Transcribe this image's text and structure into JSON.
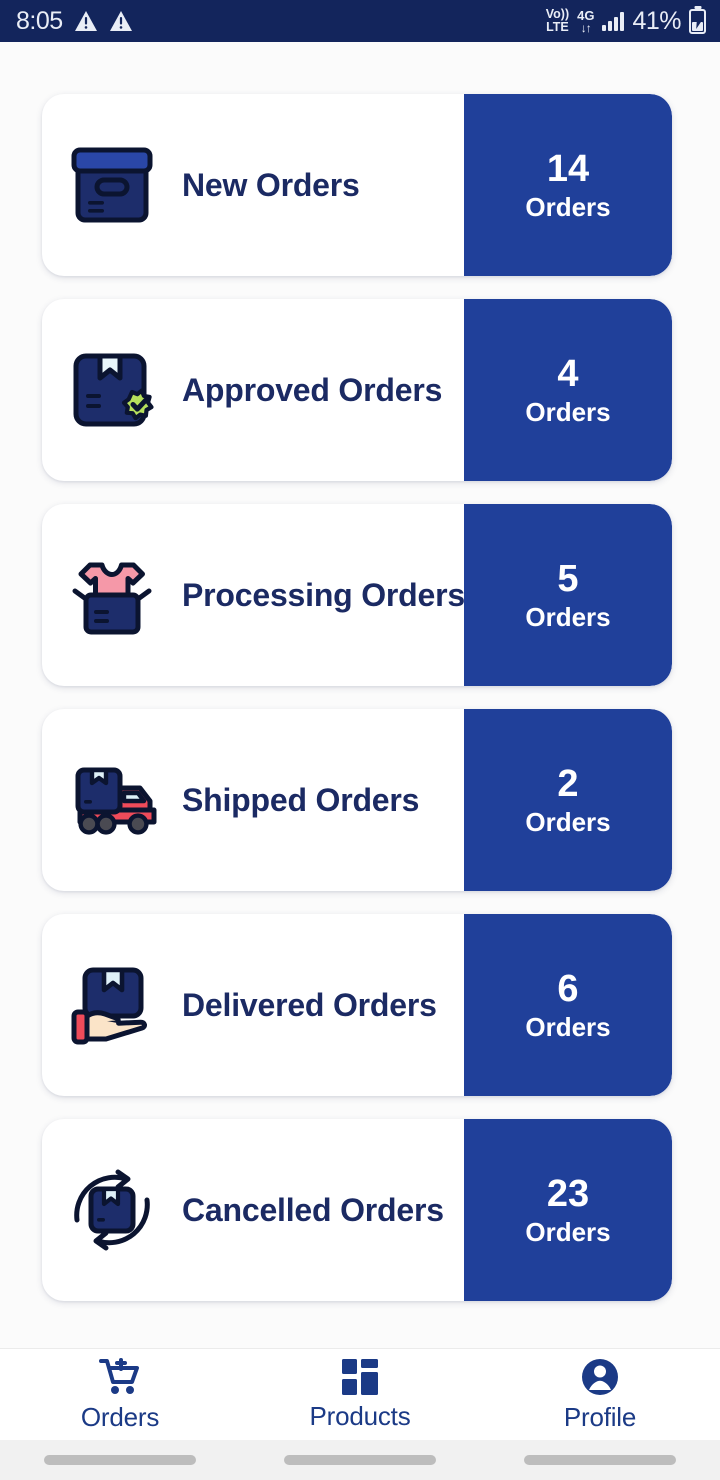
{
  "status_bar": {
    "time": "8:05",
    "warning_icons": [
      "warning-triangle-icon",
      "warning-triangle-icon"
    ],
    "volte_top": "Vo))",
    "volte_bottom": "LTE",
    "network_type": "4G",
    "data_arrows": "↓↑",
    "signal_icon": "signal-bars-icon",
    "battery_percent": "41%",
    "battery_icon": "battery-charging-icon",
    "background_color": "#13255c"
  },
  "theme": {
    "accent_blue": "#20409a",
    "title_navy": "#1b2a63",
    "page_background": "#fbfbfb",
    "card_background": "#ffffff"
  },
  "orders": {
    "cards": [
      {
        "icon": "archive-box-icon",
        "title": "New Orders",
        "count": "14",
        "unit": "Orders"
      },
      {
        "icon": "box-approved-icon",
        "title": "Approved Orders",
        "count": "4",
        "unit": "Orders"
      },
      {
        "icon": "open-box-shirt-icon",
        "title": "Processing Orders",
        "count": "5",
        "unit": "Orders"
      },
      {
        "icon": "delivery-truck-icon",
        "title": "Shipped Orders",
        "count": "2",
        "unit": "Orders"
      },
      {
        "icon": "hand-package-icon",
        "title": "Delivered Orders",
        "count": "6",
        "unit": "Orders"
      },
      {
        "icon": "box-return-arrows-icon",
        "title": "Cancelled Orders",
        "count": "23",
        "unit": "Orders"
      }
    ]
  },
  "bottom_nav": {
    "items": [
      {
        "icon": "shopping-cart-icon",
        "label": "Orders",
        "active": true
      },
      {
        "icon": "grid-squares-icon",
        "label": "Products",
        "active": false
      },
      {
        "icon": "person-circle-icon",
        "label": "Profile",
        "active": false
      }
    ]
  }
}
